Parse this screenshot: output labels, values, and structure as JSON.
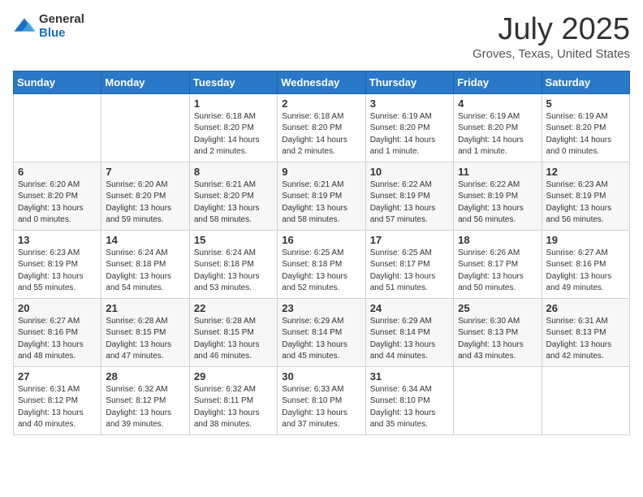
{
  "header": {
    "logo_general": "General",
    "logo_blue": "Blue",
    "month_year": "July 2025",
    "location": "Groves, Texas, United States"
  },
  "weekdays": [
    "Sunday",
    "Monday",
    "Tuesday",
    "Wednesday",
    "Thursday",
    "Friday",
    "Saturday"
  ],
  "weeks": [
    [
      null,
      null,
      {
        "day": 1,
        "sunrise": "6:18 AM",
        "sunset": "8:20 PM",
        "daylight": "14 hours and 2 minutes."
      },
      {
        "day": 2,
        "sunrise": "6:18 AM",
        "sunset": "8:20 PM",
        "daylight": "14 hours and 2 minutes."
      },
      {
        "day": 3,
        "sunrise": "6:19 AM",
        "sunset": "8:20 PM",
        "daylight": "14 hours and 1 minute."
      },
      {
        "day": 4,
        "sunrise": "6:19 AM",
        "sunset": "8:20 PM",
        "daylight": "14 hours and 1 minute."
      },
      {
        "day": 5,
        "sunrise": "6:19 AM",
        "sunset": "8:20 PM",
        "daylight": "14 hours and 0 minutes."
      }
    ],
    [
      {
        "day": 6,
        "sunrise": "6:20 AM",
        "sunset": "8:20 PM",
        "daylight": "13 hours and 0 minutes."
      },
      {
        "day": 7,
        "sunrise": "6:20 AM",
        "sunset": "8:20 PM",
        "daylight": "13 hours and 59 minutes."
      },
      {
        "day": 8,
        "sunrise": "6:21 AM",
        "sunset": "8:20 PM",
        "daylight": "13 hours and 58 minutes."
      },
      {
        "day": 9,
        "sunrise": "6:21 AM",
        "sunset": "8:19 PM",
        "daylight": "13 hours and 58 minutes."
      },
      {
        "day": 10,
        "sunrise": "6:22 AM",
        "sunset": "8:19 PM",
        "daylight": "13 hours and 57 minutes."
      },
      {
        "day": 11,
        "sunrise": "6:22 AM",
        "sunset": "8:19 PM",
        "daylight": "13 hours and 56 minutes."
      },
      {
        "day": 12,
        "sunrise": "6:23 AM",
        "sunset": "8:19 PM",
        "daylight": "13 hours and 56 minutes."
      }
    ],
    [
      {
        "day": 13,
        "sunrise": "6:23 AM",
        "sunset": "8:19 PM",
        "daylight": "13 hours and 55 minutes."
      },
      {
        "day": 14,
        "sunrise": "6:24 AM",
        "sunset": "8:18 PM",
        "daylight": "13 hours and 54 minutes."
      },
      {
        "day": 15,
        "sunrise": "6:24 AM",
        "sunset": "8:18 PM",
        "daylight": "13 hours and 53 minutes."
      },
      {
        "day": 16,
        "sunrise": "6:25 AM",
        "sunset": "8:18 PM",
        "daylight": "13 hours and 52 minutes."
      },
      {
        "day": 17,
        "sunrise": "6:25 AM",
        "sunset": "8:17 PM",
        "daylight": "13 hours and 51 minutes."
      },
      {
        "day": 18,
        "sunrise": "6:26 AM",
        "sunset": "8:17 PM",
        "daylight": "13 hours and 50 minutes."
      },
      {
        "day": 19,
        "sunrise": "6:27 AM",
        "sunset": "8:16 PM",
        "daylight": "13 hours and 49 minutes."
      }
    ],
    [
      {
        "day": 20,
        "sunrise": "6:27 AM",
        "sunset": "8:16 PM",
        "daylight": "13 hours and 48 minutes."
      },
      {
        "day": 21,
        "sunrise": "6:28 AM",
        "sunset": "8:15 PM",
        "daylight": "13 hours and 47 minutes."
      },
      {
        "day": 22,
        "sunrise": "6:28 AM",
        "sunset": "8:15 PM",
        "daylight": "13 hours and 46 minutes."
      },
      {
        "day": 23,
        "sunrise": "6:29 AM",
        "sunset": "8:14 PM",
        "daylight": "13 hours and 45 minutes."
      },
      {
        "day": 24,
        "sunrise": "6:29 AM",
        "sunset": "8:14 PM",
        "daylight": "13 hours and 44 minutes."
      },
      {
        "day": 25,
        "sunrise": "6:30 AM",
        "sunset": "8:13 PM",
        "daylight": "13 hours and 43 minutes."
      },
      {
        "day": 26,
        "sunrise": "6:31 AM",
        "sunset": "8:13 PM",
        "daylight": "13 hours and 42 minutes."
      }
    ],
    [
      {
        "day": 27,
        "sunrise": "6:31 AM",
        "sunset": "8:12 PM",
        "daylight": "13 hours and 40 minutes."
      },
      {
        "day": 28,
        "sunrise": "6:32 AM",
        "sunset": "8:12 PM",
        "daylight": "13 hours and 39 minutes."
      },
      {
        "day": 29,
        "sunrise": "6:32 AM",
        "sunset": "8:11 PM",
        "daylight": "13 hours and 38 minutes."
      },
      {
        "day": 30,
        "sunrise": "6:33 AM",
        "sunset": "8:10 PM",
        "daylight": "13 hours and 37 minutes."
      },
      {
        "day": 31,
        "sunrise": "6:34 AM",
        "sunset": "8:10 PM",
        "daylight": "13 hours and 35 minutes."
      },
      null,
      null
    ]
  ],
  "labels": {
    "sunrise": "Sunrise: ",
    "sunset": "Sunset: ",
    "daylight": "Daylight: "
  }
}
